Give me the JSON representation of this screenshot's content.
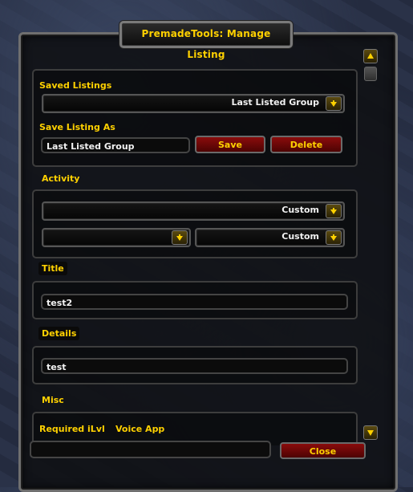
{
  "window": {
    "title": "PremadeTools: Manage Listing"
  },
  "saved": {
    "saved_listings_label": "Saved Listings",
    "saved_listings_value": "Last Listed Group",
    "save_as_label": "Save Listing As",
    "save_as_value": "Last Listed Group",
    "save_button": "Save",
    "delete_button": "Delete"
  },
  "activity": {
    "label": "Activity",
    "dropdown1_value": "Custom",
    "dropdown2_value": "",
    "dropdown3_value": "Custom"
  },
  "title_section": {
    "label": "Title",
    "value": "test2"
  },
  "details_section": {
    "label": "Details",
    "value": "test"
  },
  "misc": {
    "label": "Misc",
    "required_ilvl_label": "Required iLvl",
    "voice_app_label": "Voice App"
  },
  "footer": {
    "close_button": "Close"
  },
  "colors": {
    "gold": "#ffd100",
    "red_button": "#8a0c0c"
  }
}
